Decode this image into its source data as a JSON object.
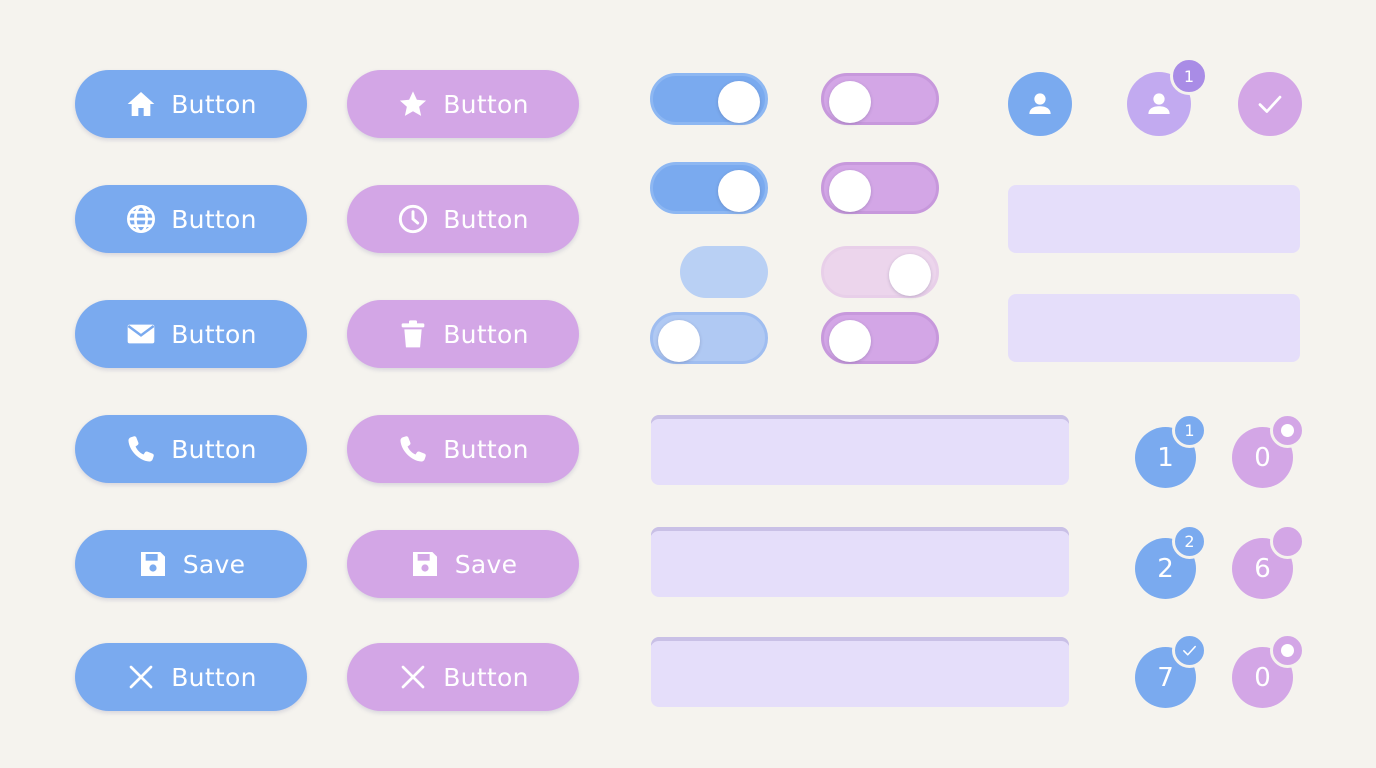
{
  "colors": {
    "blue": "#7aaaef",
    "purple": "#d3a6e6",
    "field": "#e5defa",
    "background": "#f5f3ee"
  },
  "buttons_blue": [
    {
      "label": "Button",
      "icon": "home-icon"
    },
    {
      "label": "Button",
      "icon": "globe-icon"
    },
    {
      "label": "Button",
      "icon": "mail-icon"
    },
    {
      "label": "Button",
      "icon": "phone-icon"
    },
    {
      "label": "Save",
      "icon": "save-icon"
    },
    {
      "label": "Button",
      "icon": "close-icon"
    }
  ],
  "buttons_purple": [
    {
      "label": "Button",
      "icon": "star-icon"
    },
    {
      "label": "Button",
      "icon": "clock-icon"
    },
    {
      "label": "Button",
      "icon": "trash-icon"
    },
    {
      "label": "Button",
      "icon": "phone-icon"
    },
    {
      "label": "Save",
      "icon": "save-icon"
    },
    {
      "label": "Button",
      "icon": "close-icon"
    }
  ],
  "toggles": [
    {
      "color": "blue",
      "state": "on"
    },
    {
      "color": "purple",
      "state": "off"
    },
    {
      "color": "blue",
      "state": "on"
    },
    {
      "color": "purple",
      "state": "off"
    },
    {
      "color": "blue-light",
      "state": "none"
    },
    {
      "color": "purple-light",
      "state": "on"
    },
    {
      "color": "blue-light",
      "state": "off"
    },
    {
      "color": "purple",
      "state": "off"
    }
  ],
  "avatars": [
    {
      "icon": "user-icon",
      "badge": ""
    },
    {
      "icon": "user-icon",
      "badge": "1"
    },
    {
      "icon": "check-icon",
      "badge": ""
    }
  ],
  "counters_blue": [
    {
      "value": "1",
      "badge": "1"
    },
    {
      "value": "2",
      "badge": "2"
    },
    {
      "value": "7",
      "badge": "check-icon"
    }
  ],
  "counters_purple": [
    {
      "value": "0",
      "badge": "dot-icon"
    },
    {
      "value": "6",
      "badge": ""
    },
    {
      "value": "0",
      "badge": "dot-icon"
    }
  ]
}
